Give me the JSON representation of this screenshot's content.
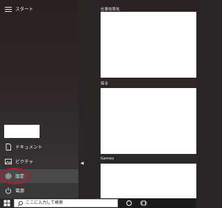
{
  "start_menu": {
    "title": "スタート",
    "folders": [
      {
        "label": "ドキュメント",
        "icon": "document-icon"
      },
      {
        "label": "ピクチャ",
        "icon": "pictures-icon"
      },
      {
        "label": "設定",
        "icon": "gear-icon"
      },
      {
        "label": "電源",
        "icon": "power-icon"
      }
    ],
    "tile_groups": [
      {
        "title": "仕事効率化"
      },
      {
        "title": "探る"
      },
      {
        "title": "Games"
      }
    ]
  },
  "taskbar": {
    "search_placeholder": "ここに入力して検索",
    "icons": [
      "windows-logo-icon",
      "search-icon",
      "cortana-icon",
      "task-view-icon"
    ]
  },
  "colors": {
    "highlight": "#c8102e",
    "tile": "#ffffff",
    "taskbar": "#1b1b1b"
  }
}
